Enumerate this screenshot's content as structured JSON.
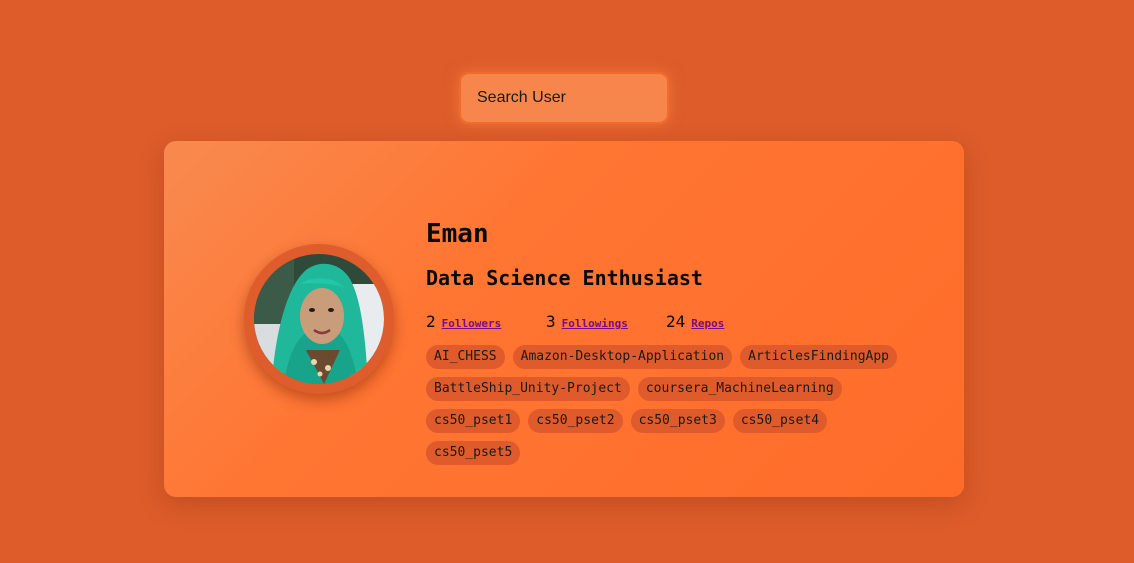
{
  "search": {
    "placeholder": "Search User"
  },
  "profile": {
    "name": "Eman",
    "bio": "Data Science Enthusiast",
    "stats": [
      {
        "count": "2",
        "label": "Followers"
      },
      {
        "count": "3",
        "label": "Followings"
      },
      {
        "count": "24",
        "label": "Repos"
      }
    ],
    "repos": [
      "AI_CHESS",
      "Amazon-Desktop-Application",
      "ArticlesFindingApp",
      "BattleShip_Unity-Project",
      "coursera_MachineLearning",
      "cs50_pset1",
      "cs50_pset2",
      "cs50_pset3",
      "cs50_pset4",
      "cs50_pset5"
    ]
  },
  "colors": {
    "background": "#dd5c2a",
    "card": "#ff7532",
    "repo_chip": "#e05b2c",
    "link": "#7a0a8a"
  }
}
